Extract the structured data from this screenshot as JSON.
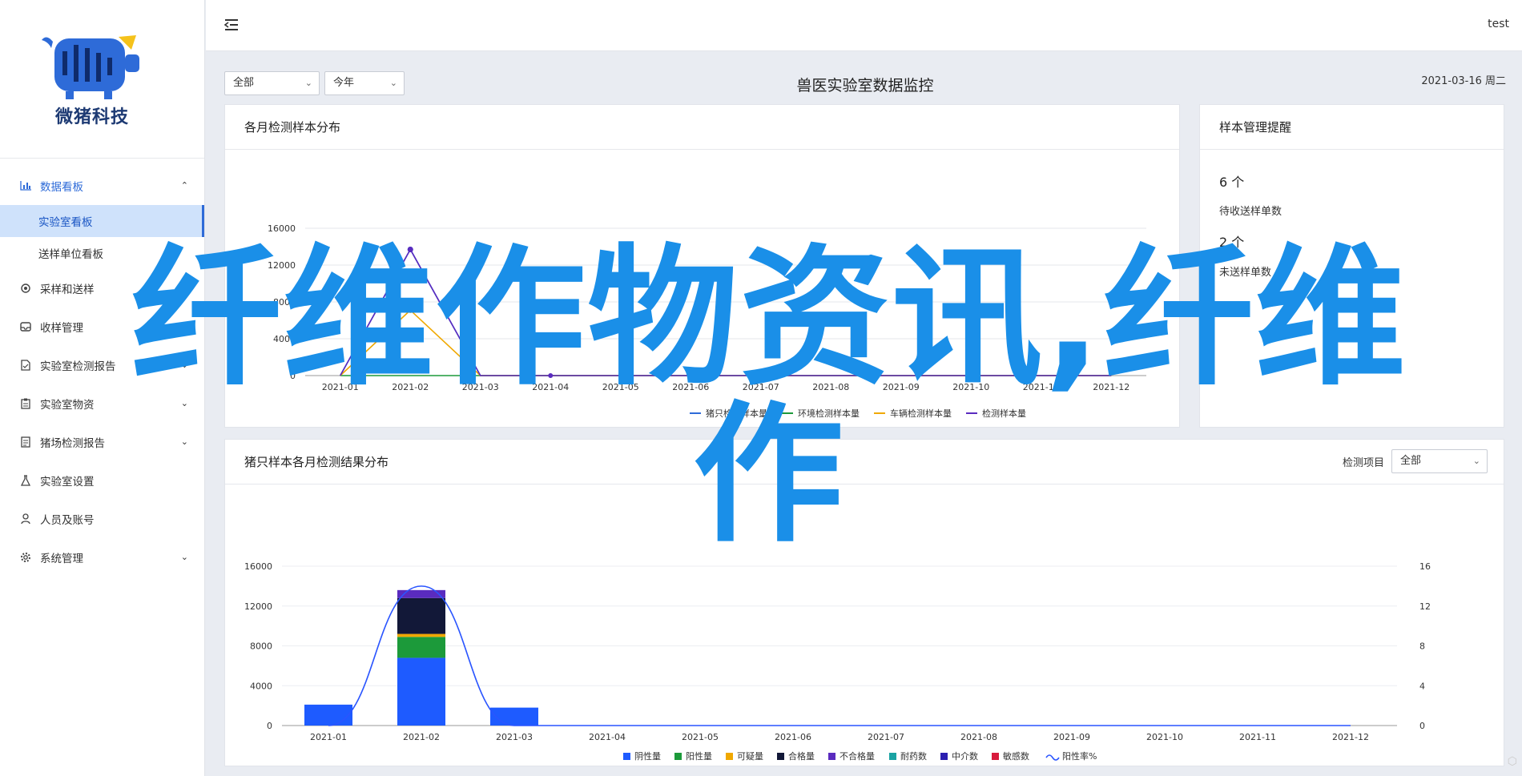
{
  "app": {
    "brand": "微猪科技",
    "user": "test"
  },
  "sidebar": {
    "groups": [
      {
        "label": "数据看板",
        "icon": "bar-chart-icon",
        "expanded": true,
        "children": [
          {
            "label": "实验室看板",
            "active": true
          },
          {
            "label": "送样单位看板",
            "active": false
          }
        ]
      },
      {
        "label": "采样和送样",
        "icon": "sample-icon"
      },
      {
        "label": "收样管理",
        "icon": "inbox-icon"
      },
      {
        "label": "实验室检测报告",
        "icon": "report-icon"
      },
      {
        "label": "实验室物资",
        "icon": "clipboard-icon"
      },
      {
        "label": "猪场检测报告",
        "icon": "document-icon"
      },
      {
        "label": "实验室设置",
        "icon": "flask-icon"
      },
      {
        "label": "人员及账号",
        "icon": "user-icon"
      },
      {
        "label": "系统管理",
        "icon": "gear-icon"
      }
    ]
  },
  "filters": {
    "range": "全部",
    "period": "今年"
  },
  "page": {
    "title": "兽医实验室数据监控",
    "date": "2021-03-16 周二"
  },
  "monthly_card": {
    "title": "各月检测样本分布"
  },
  "reminder_card": {
    "title": "样本管理提醒",
    "items": [
      {
        "value": "6 个",
        "label": "待收送样单数"
      },
      {
        "value": "2 个",
        "label": "未送样单数"
      }
    ]
  },
  "result_card": {
    "title": "猪只样本各月检测结果分布",
    "filter_label": "检测项目",
    "filter_value": "全部"
  },
  "overlay": {
    "text": "纤维作物资讯,纤维作"
  },
  "colors": {
    "accent": "#2e6bd8",
    "positive": "#1e5bff",
    "yang": "#1c9a3a",
    "suspicious": "#f0a800",
    "qualified": "#121838",
    "unqualified": "#5a2bbf",
    "resistant": "#1aa3a3",
    "mid": "#2b1fb0",
    "sensitive": "#d81b3c",
    "rate_line": "#2a55ff",
    "watermark": "#1a8fe8"
  },
  "chart_data": [
    {
      "type": "line",
      "title": "各月检测样本分布",
      "x": [
        "2021-01",
        "2021-02",
        "2021-03",
        "2021-04",
        "2021-05",
        "2021-06",
        "2021-07",
        "2021-08",
        "2021-09",
        "2021-10",
        "2021-11",
        "2021-12"
      ],
      "ylim": [
        0,
        16000
      ],
      "yticks": [
        0,
        4000,
        8000,
        12000,
        16000
      ],
      "grid": true,
      "legend": "bottom",
      "series": [
        {
          "name": "猪只检测样本量",
          "color": "#2e6bd8",
          "values": [
            0,
            13700,
            0,
            0,
            0,
            0,
            0,
            0,
            0,
            0,
            0,
            0
          ]
        },
        {
          "name": "环境检测样本量",
          "color": "#1c9a3a",
          "values": [
            0,
            0,
            0,
            0,
            0,
            0,
            0,
            0,
            0,
            0,
            0,
            0
          ]
        },
        {
          "name": "车辆检测样本量",
          "color": "#f0a800",
          "values": [
            0,
            7100,
            0,
            0,
            0,
            0,
            0,
            0,
            0,
            0,
            0,
            0
          ]
        },
        {
          "name": "检测样本量",
          "color": "#5a2bbf",
          "values": [
            0,
            13700,
            0,
            0,
            0,
            0,
            0,
            0,
            0,
            0,
            0,
            0
          ]
        }
      ]
    },
    {
      "type": "bar",
      "title": "猪只样本各月检测结果分布",
      "categories": [
        "2021-01",
        "2021-02",
        "2021-03",
        "2021-04",
        "2021-05",
        "2021-06",
        "2021-07",
        "2021-08",
        "2021-09",
        "2021-10",
        "2021-11",
        "2021-12"
      ],
      "ylim": [
        0,
        16000
      ],
      "yticks": [
        0,
        4000,
        8000,
        12000,
        16000
      ],
      "y2lim": [
        0,
        16
      ],
      "y2ticks": [
        0,
        4,
        8,
        12,
        16
      ],
      "legend": "bottom",
      "stacked": true,
      "series": [
        {
          "name": "阴性量",
          "color": "#1e5bff",
          "values": [
            2100,
            6800,
            1800,
            0,
            0,
            0,
            0,
            0,
            0,
            0,
            0,
            0
          ]
        },
        {
          "name": "阳性量",
          "color": "#1c9a3a",
          "values": [
            0,
            2100,
            0,
            0,
            0,
            0,
            0,
            0,
            0,
            0,
            0,
            0
          ]
        },
        {
          "name": "可疑量",
          "color": "#f0a800",
          "values": [
            0,
            300,
            0,
            0,
            0,
            0,
            0,
            0,
            0,
            0,
            0,
            0
          ]
        },
        {
          "name": "合格量",
          "color": "#121838",
          "values": [
            0,
            3600,
            0,
            0,
            0,
            0,
            0,
            0,
            0,
            0,
            0,
            0
          ]
        },
        {
          "name": "不合格量",
          "color": "#5a2bbf",
          "values": [
            0,
            800,
            0,
            0,
            0,
            0,
            0,
            0,
            0,
            0,
            0,
            0
          ]
        },
        {
          "name": "耐药数",
          "color": "#1aa3a3",
          "values": [
            0,
            0,
            0,
            0,
            0,
            0,
            0,
            0,
            0,
            0,
            0,
            0
          ]
        },
        {
          "name": "中介数",
          "color": "#2b1fb0",
          "values": [
            0,
            0,
            0,
            0,
            0,
            0,
            0,
            0,
            0,
            0,
            0,
            0
          ]
        },
        {
          "name": "敏感数",
          "color": "#d81b3c",
          "values": [
            0,
            0,
            0,
            0,
            0,
            0,
            0,
            0,
            0,
            0,
            0,
            0
          ]
        }
      ],
      "line_series": {
        "name": "阳性率%",
        "color": "#2a55ff",
        "axis": "right",
        "values": [
          0,
          14,
          0,
          0,
          0,
          0,
          0,
          0,
          0,
          0,
          0,
          0
        ]
      }
    }
  ]
}
